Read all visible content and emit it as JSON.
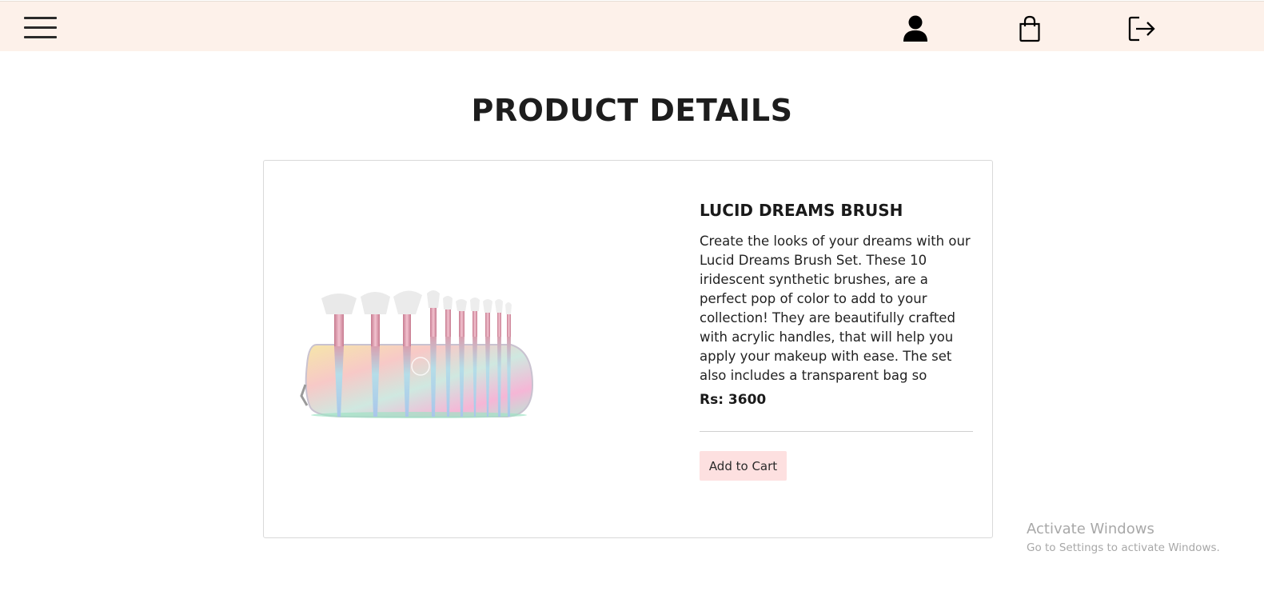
{
  "navbar": {
    "menu_icon": "hamburger-menu-icon",
    "icons": [
      "user-icon",
      "shopping-bag-icon",
      "logout-icon"
    ],
    "background": "#fdf1ea"
  },
  "page": {
    "title": "PRODUCT DETAILS"
  },
  "product": {
    "name": "LUCID DREAMS BRUSH",
    "description": "Create the looks of your dreams with our Lucid Dreams Brush Set. These 10 iridescent synthetic brushes, are a perfect pop of color to add to your collection! They are beautifully crafted with acrylic handles, that will help you apply your makeup with ease. The set also includes a transparent bag so",
    "price_label": "Rs: 3600",
    "add_to_cart_label": "Add to Cart",
    "button_color": "#fde0e0",
    "image_icon": "makeup-brush-set-image"
  },
  "watermark": {
    "title": "Activate Windows",
    "subtitle": "Go to Settings to activate Windows."
  }
}
